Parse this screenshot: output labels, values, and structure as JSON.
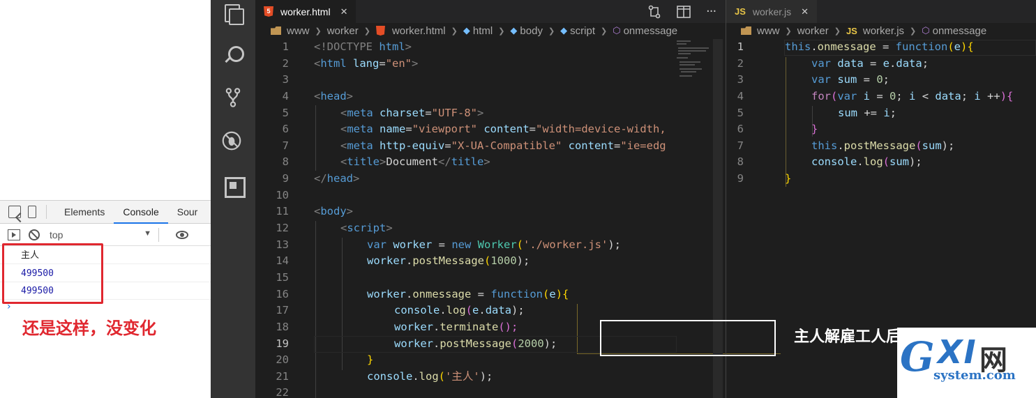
{
  "devtools": {
    "tabs": [
      "Elements",
      "Console",
      "Sour"
    ],
    "context": "top",
    "console_lines": [
      "主人",
      "499500",
      "499500"
    ],
    "prompt": "›",
    "annotation": "还是这样，没变化"
  },
  "editor_left": {
    "tab_title": "worker.html",
    "tab_close": "✕",
    "breadcrumb": [
      "www",
      "worker",
      "worker.html",
      "html",
      "body",
      "script",
      "onmessage"
    ],
    "line_numbers": [
      "1",
      "2",
      "3",
      "4",
      "5",
      "6",
      "7",
      "8",
      "9",
      "10",
      "11",
      "12",
      "13",
      "14",
      "15",
      "16",
      "17",
      "18",
      "19",
      "20",
      "21",
      "22"
    ],
    "current_line": "19",
    "code_text": {
      "l1a": "<!DOCTYPE",
      "l1b": " html",
      "l1c": ">",
      "l2a": "<",
      "l2b": "html",
      "l2c": " lang",
      "l2d": "=",
      "l2e": "\"en\"",
      "l2f": ">",
      "l4a": "<",
      "l4b": "head",
      "l4c": ">",
      "l5a": "<",
      "l5b": "meta",
      "l5c": " charset",
      "l5d": "=",
      "l5e": "\"UTF-8\"",
      "l5f": ">",
      "l6a": "<",
      "l6b": "meta",
      "l6c": " name",
      "l6d": "=",
      "l6e": "\"viewport\"",
      "l6f": " content",
      "l6g": "=",
      "l6h": "\"width=device-width,",
      "l7a": "<",
      "l7b": "meta",
      "l7c": " http-equiv",
      "l7d": "=",
      "l7e": "\"X-UA-Compatible\"",
      "l7f": " content",
      "l7g": "=",
      "l7h": "\"ie=edg",
      "l8a": "<",
      "l8b": "title",
      "l8c": ">",
      "l8d": "Document",
      "l8e": "</",
      "l8f": "title",
      "l8g": ">",
      "l9a": "</",
      "l9b": "head",
      "l9c": ">",
      "l11a": "<",
      "l11b": "body",
      "l11c": ">",
      "l12a": "<",
      "l12b": "script",
      "l12c": ">",
      "l13a": "var",
      "l13b": " worker",
      "l13c": " = ",
      "l13d": "new",
      "l13e": " Worker",
      "l13f": "(",
      "l13g": "'./worker.js'",
      "l13h": ");",
      "l14a": "worker",
      "l14b": ".",
      "l14c": "postMessage",
      "l14d": "(",
      "l14e": "1000",
      "l14f": ");",
      "l16a": "worker",
      "l16b": ".",
      "l16c": "onmessage",
      "l16d": " = ",
      "l16e": "function",
      "l16f": "(",
      "l16g": "e",
      "l16h": "){",
      "l17a": "console",
      "l17b": ".",
      "l17c": "log",
      "l17d": "(",
      "l17e": "e",
      "l17f": ".",
      "l17g": "data",
      "l17h": ");",
      "l18a": "worker",
      "l18b": ".",
      "l18c": "terminate",
      "l18d": "();",
      "l19a": "worker",
      "l19b": ".",
      "l19c": "postMessage",
      "l19d": "(",
      "l19e": "2000",
      "l19f": ");",
      "l20a": "}",
      "l21a": "console",
      "l21b": ".",
      "l21c": "log",
      "l21d": "(",
      "l21e": "'主人'",
      "l21f": ");"
    },
    "annotation": "主人解雇工人后，再传数据，工人无法接收到"
  },
  "editor_right": {
    "tab_title": "worker.js",
    "tab_close": "✕",
    "breadcrumb": [
      "www",
      "worker",
      "worker.js",
      "onmessage"
    ],
    "line_numbers": [
      "1",
      "2",
      "3",
      "4",
      "5",
      "6",
      "7",
      "8",
      "9"
    ],
    "code_text": {
      "r1a": "this",
      "r1b": ".",
      "r1c": "onmessage",
      "r1d": " = ",
      "r1e": "function",
      "r1f": "(",
      "r1g": "e",
      "r1h": "){",
      "r2a": "var",
      "r2b": " data",
      "r2c": " = ",
      "r2d": "e",
      "r2e": ".",
      "r2f": "data",
      "r2g": ";",
      "r3a": "var",
      "r3b": " sum",
      "r3c": " = ",
      "r3d": "0",
      "r3e": ";",
      "r4a": "for",
      "r4b": "(",
      "r4c": "var",
      "r4d": " i",
      "r4e": " = ",
      "r4f": "0",
      "r4g": "; ",
      "r4h": "i",
      "r4i": " < ",
      "r4j": "data",
      "r4k": "; ",
      "r4l": "i",
      "r4m": " ++",
      "r4n": "){",
      "r5a": "sum",
      "r5b": " += ",
      "r5c": "i",
      "r5d": ";",
      "r6a": "}",
      "r7a": "this",
      "r7b": ".",
      "r7c": "postMessage",
      "r7d": "(",
      "r7e": "sum",
      "r7f": ");",
      "r8a": "console",
      "r8b": ".",
      "r8c": "log",
      "r8d": "(",
      "r8e": "sum",
      "r8f": ");",
      "r9a": "}"
    }
  },
  "watermark": {
    "g": "G",
    "xi": "XI",
    "cn": "网",
    "domain": "system.com"
  },
  "colors": {
    "annotation_red": "#e0272f",
    "editor_bg": "#1e1e1e",
    "activity_bg": "#333333",
    "accent_blue": "#1a73e8"
  }
}
